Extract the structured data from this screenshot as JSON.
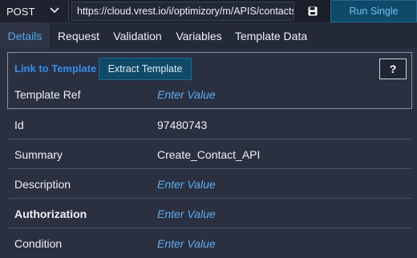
{
  "request": {
    "method": "POST",
    "url": "https://cloud.vrest.io/i/optimizory/m/APIS/contacts",
    "run_label": "Run Single"
  },
  "tabs": [
    {
      "label": "Details",
      "active": true
    },
    {
      "label": "Request",
      "active": false
    },
    {
      "label": "Validation",
      "active": false
    },
    {
      "label": "Variables",
      "active": false
    },
    {
      "label": "Template Data",
      "active": false
    }
  ],
  "template": {
    "link_label": "Link to Template",
    "extract_label": "Extract Template",
    "help_label": "?",
    "ref_label": "Template Ref",
    "ref_value": "Enter Value"
  },
  "fields": [
    {
      "label": "Id",
      "value": "97480743"
    },
    {
      "label": "Summary",
      "value": "Create_Contact_API"
    },
    {
      "label": "Description",
      "value": "Enter Value"
    },
    {
      "label": "Authorization",
      "value": "Enter Value"
    },
    {
      "label": "Condition",
      "value": "Enter Value"
    }
  ],
  "colors": {
    "accent": "#4aa8f0",
    "placeholder": "#5aaef0",
    "background": "#2b3040",
    "button": "#0f4a68"
  },
  "icons": {
    "method_dropdown": "chevron-down-icon",
    "save": "save-icon"
  }
}
